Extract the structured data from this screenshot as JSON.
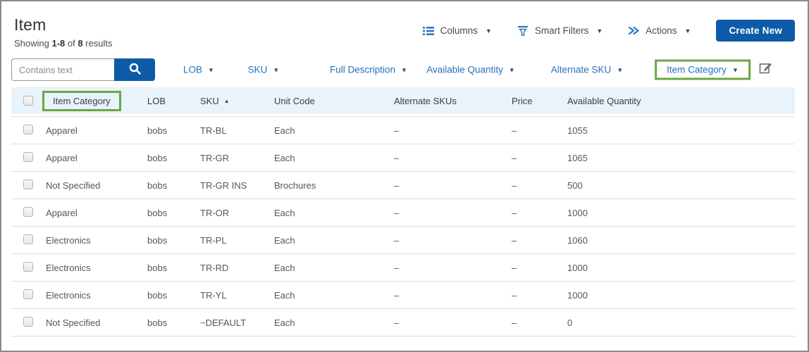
{
  "page": {
    "title": "Item",
    "results": {
      "showing": "Showing",
      "range": "1-8",
      "of": "of",
      "total": "8",
      "results_word": "results"
    }
  },
  "toolbar": {
    "columns_label": "Columns",
    "smart_filters_label": "Smart Filters",
    "actions_label": "Actions",
    "create_new_label": "Create New"
  },
  "filters": {
    "search_placeholder": "Contains text",
    "dropdowns": [
      {
        "label": "LOB",
        "highlighted": false
      },
      {
        "label": "SKU",
        "highlighted": false
      },
      {
        "label": "Full Description",
        "highlighted": false
      },
      {
        "label": "Available Quantity",
        "highlighted": false
      },
      {
        "label": "Alternate SKU",
        "highlighted": false
      },
      {
        "label": "Item Category",
        "highlighted": true
      }
    ]
  },
  "table": {
    "columns": [
      "Item Category",
      "LOB",
      "SKU",
      "Unit Code",
      "Alternate SKUs",
      "Price",
      "Available Quantity"
    ],
    "sort_column": "SKU",
    "sort_direction": "ascending",
    "highlighted_column": "Item Category",
    "rows": [
      {
        "item_category": "Apparel",
        "lob": "bobs",
        "sku": "TR-BL",
        "unit_code": "Each",
        "alternate_skus": "–",
        "price": "–",
        "available_quantity": "1055"
      },
      {
        "item_category": "Apparel",
        "lob": "bobs",
        "sku": "TR-GR",
        "unit_code": "Each",
        "alternate_skus": "–",
        "price": "–",
        "available_quantity": "1065"
      },
      {
        "item_category": "Not Specified",
        "lob": "bobs",
        "sku": "TR-GR INS",
        "unit_code": "Brochures",
        "alternate_skus": "–",
        "price": "–",
        "available_quantity": "500"
      },
      {
        "item_category": "Apparel",
        "lob": "bobs",
        "sku": "TR-OR",
        "unit_code": "Each",
        "alternate_skus": "–",
        "price": "–",
        "available_quantity": "1000"
      },
      {
        "item_category": "Electronics",
        "lob": "bobs",
        "sku": "TR-PL",
        "unit_code": "Each",
        "alternate_skus": "–",
        "price": "–",
        "available_quantity": "1060"
      },
      {
        "item_category": "Electronics",
        "lob": "bobs",
        "sku": "TR-RD",
        "unit_code": "Each",
        "alternate_skus": "–",
        "price": "–",
        "available_quantity": "1000"
      },
      {
        "item_category": "Electronics",
        "lob": "bobs",
        "sku": "TR-YL",
        "unit_code": "Each",
        "alternate_skus": "–",
        "price": "–",
        "available_quantity": "1000"
      },
      {
        "item_category": "Not Specified",
        "lob": "bobs",
        "sku": "~DEFAULT",
        "unit_code": "Each",
        "alternate_skus": "–",
        "price": "–",
        "available_quantity": "0"
      }
    ]
  },
  "icons": {
    "caret_down": "▼",
    "sort_asc": "▲"
  },
  "colors": {
    "accent_blue": "#0d5aa7",
    "link_blue": "#2373b9",
    "icon_blue": "#2f74b9",
    "header_row_bg": "#e9f3fb",
    "highlight_green": "#6aa63f",
    "frame_border": "#8a8a8a"
  }
}
